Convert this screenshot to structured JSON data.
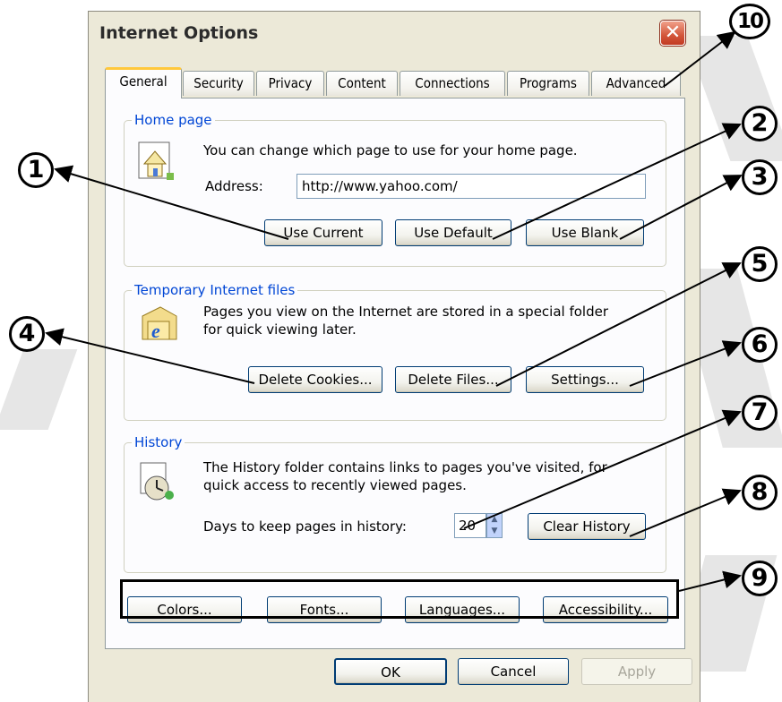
{
  "window": {
    "title": "Internet Options",
    "close_label": "✕"
  },
  "tabs": [
    "General",
    "Security",
    "Privacy",
    "Content",
    "Connections",
    "Programs",
    "Advanced"
  ],
  "home_page": {
    "label": "Home page",
    "description": "You can change which page to use for your home page.",
    "address_label": "Address:",
    "address_value": "http://www.yahoo.com/",
    "use_current": "Use Current",
    "use_default": "Use Default",
    "use_blank": "Use Blank"
  },
  "temp_files": {
    "label": "Temporary Internet files",
    "description_line1": "Pages you view on the Internet are stored in a special folder",
    "description_line2": "for quick viewing later.",
    "delete_cookies": "Delete Cookies...",
    "delete_files": "Delete Files...",
    "settings": "Settings..."
  },
  "history": {
    "label": "History",
    "description_line1": "The History folder contains links to pages you've visited, for",
    "description_line2": "quick access to recently viewed pages.",
    "days_label": "Days to keep pages in history:",
    "days_value": "20",
    "clear_history": "Clear History"
  },
  "bottom_buttons": {
    "colors": "Colors...",
    "fonts": "Fonts...",
    "languages": "Languages...",
    "accessibility": "Accessibility..."
  },
  "dialog_buttons": {
    "ok": "OK",
    "cancel": "Cancel",
    "apply": "Apply"
  },
  "callouts": [
    "1",
    "2",
    "3",
    "4",
    "5",
    "6",
    "7",
    "8",
    "9",
    "10"
  ],
  "colors": {
    "group_label": "#0046d5",
    "active_tab_accent": "#ffc83c",
    "close_button": "#d3563a"
  }
}
